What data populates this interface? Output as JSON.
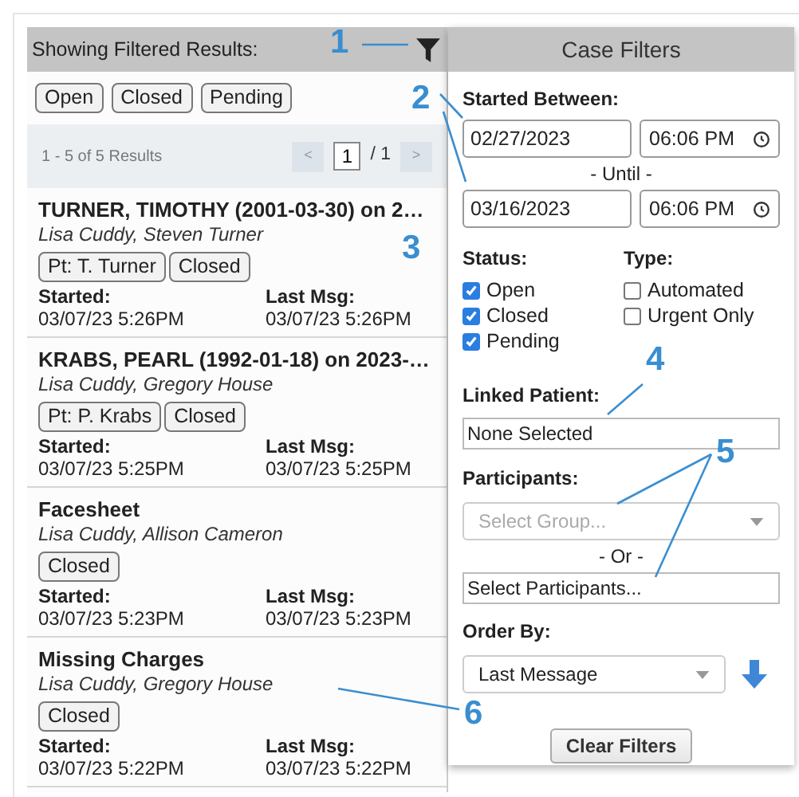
{
  "results_panel": {
    "header": "Showing Filtered Results:",
    "active_filters": [
      "Open",
      "Closed",
      "Pending"
    ],
    "summary": "1 - 5 of 5 Results",
    "pagination": {
      "prev": "<",
      "page": "1",
      "total": "/ 1",
      "next": ">"
    }
  },
  "cases": [
    {
      "title": "TURNER, TIMOTHY (2001-03-30) on 2…",
      "participants": "Lisa Cuddy, Steven Turner",
      "tags": [
        "Pt: T. Turner",
        "Closed"
      ],
      "started_label": "Started:",
      "started": "03/07/23 5:26PM",
      "last_label": "Last Msg:",
      "last": "03/07/23 5:26PM"
    },
    {
      "title": "KRABS, PEARL (1992-01-18) on 2023-…",
      "participants": "Lisa Cuddy, Gregory House",
      "tags": [
        "Pt: P. Krabs",
        "Closed"
      ],
      "started_label": "Started:",
      "started": "03/07/23 5:25PM",
      "last_label": "Last Msg:",
      "last": "03/07/23 5:25PM"
    },
    {
      "title": "Facesheet",
      "participants": "Lisa Cuddy, Allison Cameron",
      "tags": [
        "Closed"
      ],
      "started_label": "Started:",
      "started": "03/07/23 5:23PM",
      "last_label": "Last Msg:",
      "last": "03/07/23 5:23PM"
    },
    {
      "title": "Missing Charges",
      "participants": "Lisa Cuddy, Gregory House",
      "tags": [
        "Closed"
      ],
      "started_label": "Started:",
      "started": "03/07/23 5:22PM",
      "last_label": "Last Msg:",
      "last": "03/07/23 5:22PM"
    }
  ],
  "filters": {
    "title": "Case Filters",
    "started_between": "Started Between:",
    "from_date": "02/27/2023",
    "from_time": "06:06 PM",
    "until": "- Until -",
    "to_date": "03/16/2023",
    "to_time": "06:06 PM",
    "status_label": "Status:",
    "status": [
      {
        "label": "Open",
        "checked": true
      },
      {
        "label": "Closed",
        "checked": true
      },
      {
        "label": "Pending",
        "checked": true
      }
    ],
    "type_label": "Type:",
    "type": [
      {
        "label": "Automated",
        "checked": false
      },
      {
        "label": "Urgent Only",
        "checked": false
      }
    ],
    "linked_patient_label": "Linked Patient:",
    "linked_patient": "None Selected",
    "participants_label": "Participants:",
    "group_placeholder": "Select Group...",
    "or": "- Or -",
    "participants_field": "Select Participants...",
    "order_by_label": "Order By:",
    "order_by": "Last Message",
    "clear": "Clear Filters"
  },
  "callouts": [
    "1",
    "2",
    "3",
    "4",
    "5",
    "6"
  ]
}
